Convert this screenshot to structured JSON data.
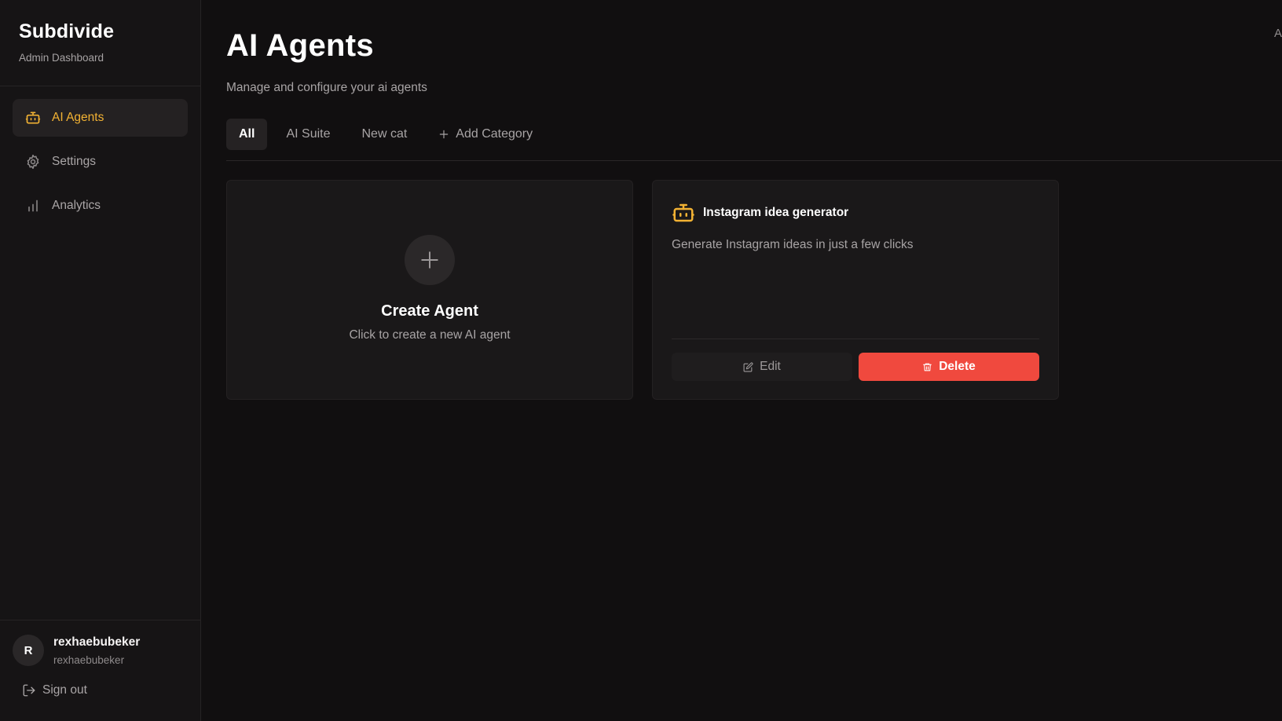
{
  "brand": {
    "title": "Subdivide",
    "subtitle": "Admin Dashboard"
  },
  "sidebar": {
    "items": [
      {
        "label": "AI Agents",
        "icon": "bot-icon",
        "active": true
      },
      {
        "label": "Settings",
        "icon": "gear-icon",
        "active": false
      },
      {
        "label": "Analytics",
        "icon": "bar-chart-icon",
        "active": false
      }
    ]
  },
  "user": {
    "initial": "R",
    "name": "rexhaebubeker",
    "handle": "rexhaebubeker"
  },
  "signout": {
    "label": "Sign out"
  },
  "page": {
    "title": "AI Agents",
    "subtitle": "Manage and configure your ai agents",
    "corner_text": "A"
  },
  "tabs": [
    {
      "label": "All",
      "active": true
    },
    {
      "label": "AI Suite",
      "active": false
    },
    {
      "label": "New cat",
      "active": false
    }
  ],
  "add_category": {
    "label": "Add Category"
  },
  "create_card": {
    "title": "Create Agent",
    "subtitle": "Click to create a new AI agent"
  },
  "agents": [
    {
      "title": "Instagram idea generator",
      "description": "Generate Instagram ideas in just a few clicks",
      "edit_label": "Edit",
      "delete_label": "Delete"
    }
  ],
  "colors": {
    "accent": "#f2b233",
    "danger": "#f0493e",
    "background": "#110f10",
    "sidebar": "#161415"
  }
}
